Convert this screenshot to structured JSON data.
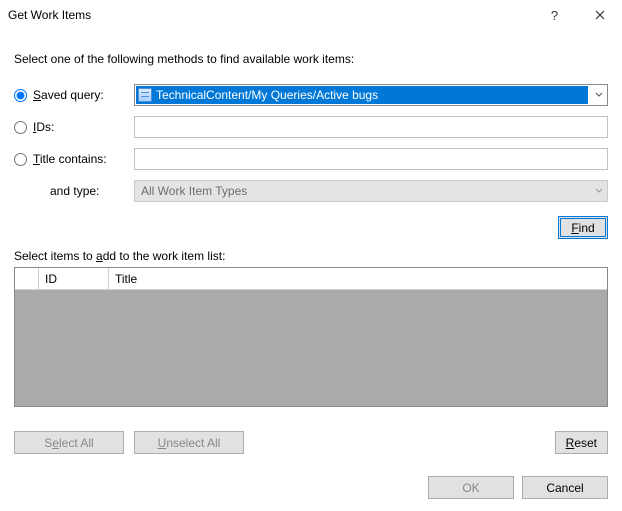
{
  "title": "Get Work Items",
  "instruction": "Select one of the following methods to find available work items:",
  "methods": {
    "saved_query": {
      "label": "Saved query:",
      "value": "TechnicalContent/My Queries/Active bugs",
      "checked": true
    },
    "ids": {
      "label": "IDs:",
      "value": "",
      "checked": false
    },
    "title_contains": {
      "label": "Title contains:",
      "value": "",
      "checked": false
    }
  },
  "and_type": {
    "label": "and type:",
    "value": "All Work Item Types"
  },
  "buttons": {
    "find": "Find",
    "select_all": "Select All",
    "unselect_all": "Unselect All",
    "reset": "Reset",
    "ok": "OK",
    "cancel": "Cancel"
  },
  "select_instruction": "Select items to add to the work item list:",
  "grid": {
    "columns": {
      "id": "ID",
      "title": "Title"
    },
    "rows": []
  }
}
